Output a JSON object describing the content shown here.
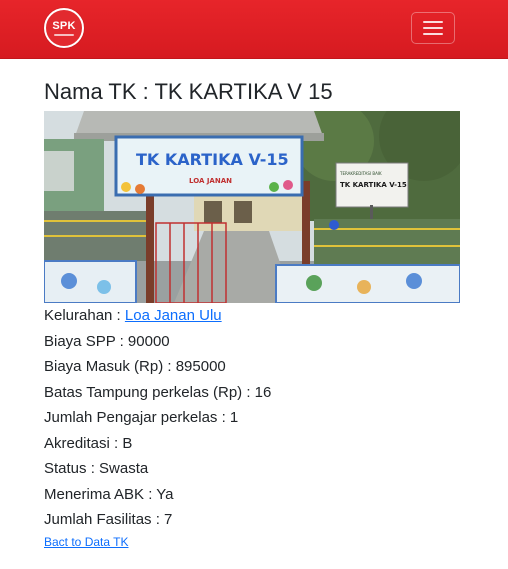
{
  "nav": {
    "logo_text": "SPK",
    "brand_color": "#dc1f25",
    "menu_icon": "hamburger-icon"
  },
  "page": {
    "title": "Nama TK : TK KARTIKA V 15"
  },
  "photo": {
    "sign_text": "TK KARTIKA V-15",
    "sign_subtext": "LOA JANAN",
    "side_sign_line1": "TERAKREDITASI BAIK",
    "side_sign_line2": "TK KARTIKA V-15"
  },
  "details": {
    "kelurahan_label": "Kelurahan : ",
    "kelurahan_value": "Loa Janan Ulu",
    "spp": "Biaya SPP : 90000",
    "masuk": "Biaya Masuk (Rp) : 895000",
    "tampung": "Batas Tampung perkelas (Rp) : 16",
    "pengajar": "Jumlah Pengajar perkelas : 1",
    "akreditasi": "Akreditasi : B",
    "status": "Status : Swasta",
    "abk": "Menerima ABK : Ya",
    "fasilitas": "Jumlah Fasilitas : 7"
  },
  "back_link": "Bact to Data TK",
  "colors": {
    "link": "#0d6efd",
    "text": "#212529"
  }
}
